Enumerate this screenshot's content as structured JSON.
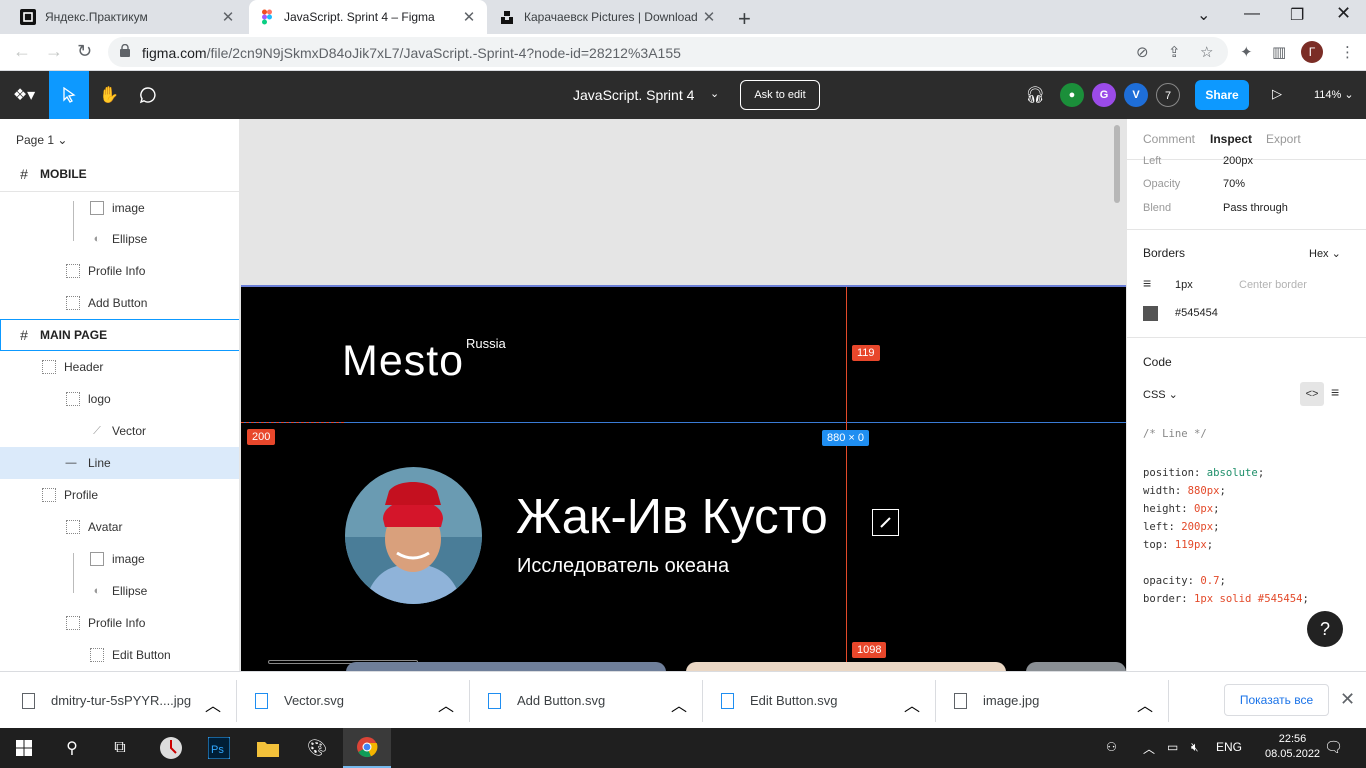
{
  "browser": {
    "tabs": [
      {
        "title": "Яндекс.Практикум",
        "active": false
      },
      {
        "title": "JavaScript. Sprint 4 – Figma",
        "active": true
      },
      {
        "title": "Карачаевск Pictures | Download",
        "active": false
      }
    ],
    "url_host": "figma.com",
    "url_path": "/file/2cn9N9jSkmxD84oJik7xL7/JavaScript.-Sprint-4?node-id=28212%3A155",
    "profile_initial": "Г"
  },
  "figma": {
    "file_title": "JavaScript. Sprint 4",
    "ask_to_edit": "Ask to edit",
    "avatars": [
      "G",
      "V",
      "7"
    ],
    "share": "Share",
    "zoom": "114%"
  },
  "layers": {
    "page": "Page 1",
    "items": [
      {
        "label": "MOBILE",
        "kind": "frame"
      },
      {
        "label": "image",
        "kind": "image"
      },
      {
        "label": "Ellipse",
        "kind": "ellipse"
      },
      {
        "label": "Profile Info",
        "kind": "group"
      },
      {
        "label": "Add Button",
        "kind": "group"
      },
      {
        "label": "MAIN PAGE",
        "kind": "frame"
      },
      {
        "label": "Header",
        "kind": "group"
      },
      {
        "label": "logo",
        "kind": "group"
      },
      {
        "label": "Vector",
        "kind": "vector"
      },
      {
        "label": "Line",
        "kind": "line",
        "selected": true
      },
      {
        "label": "Profile",
        "kind": "group"
      },
      {
        "label": "Avatar",
        "kind": "group"
      },
      {
        "label": "image",
        "kind": "image"
      },
      {
        "label": "Ellipse",
        "kind": "ellipse"
      },
      {
        "label": "Profile Info",
        "kind": "group"
      },
      {
        "label": "Edit Button",
        "kind": "group"
      }
    ]
  },
  "canvas": {
    "logo": "Mesto",
    "logo_sup": "Russia",
    "profile_name": "Жак-Ив Кусто",
    "profile_job": "Исследователь океана",
    "measure_top": "119",
    "measure_left": "200",
    "measure_size": "880 × 0",
    "measure_bottom": "1098"
  },
  "inspect": {
    "tabs": [
      "Comment",
      "Inspect",
      "Export"
    ],
    "left_label": "Left",
    "left_value": "200px",
    "opacity_label": "Opacity",
    "opacity_value": "70%",
    "blend_label": "Blend",
    "blend_value": "Pass through",
    "borders_title": "Borders",
    "color_format": "Hex",
    "border_width": "1px",
    "border_position": "Center border",
    "border_color": "#545454",
    "code_title": "Code",
    "code_lang": "CSS",
    "code": {
      "comment": "/* Line */",
      "lines": [
        {
          "prop": "position",
          "value": "absolute",
          "type": "kw"
        },
        {
          "prop": "width",
          "value": "880px",
          "type": "num"
        },
        {
          "prop": "height",
          "value": "0px",
          "type": "num"
        },
        {
          "prop": "left",
          "value": "200px",
          "type": "num"
        },
        {
          "prop": "top",
          "value": "119px",
          "type": "num"
        }
      ],
      "lines2": [
        {
          "prop": "opacity",
          "value": "0.7",
          "type": "num"
        },
        {
          "prop": "border",
          "value": "1px solid #545454",
          "type": "num"
        }
      ]
    }
  },
  "downloads": {
    "items": [
      "dmitry-tur-5sPYYR....jpg",
      "Vector.svg",
      "Add Button.svg",
      "Edit Button.svg",
      "image.jpg"
    ],
    "show_all": "Показать все"
  },
  "taskbar": {
    "lang": "ENG",
    "time": "22:56",
    "date": "08.05.2022"
  }
}
